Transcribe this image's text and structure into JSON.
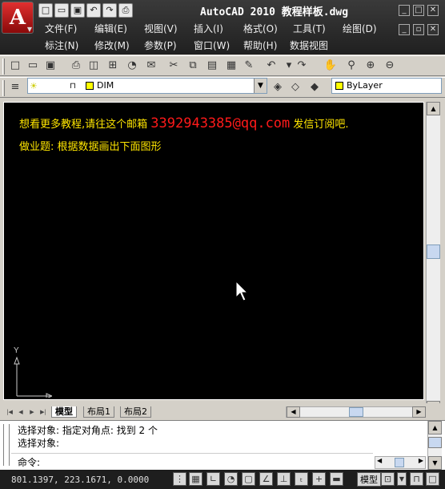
{
  "window": {
    "title": "AutoCAD 2010   教程样板.dwg",
    "logo_letter": "A"
  },
  "menus": {
    "row1": [
      "文件(F)",
      "编辑(E)",
      "视图(V)",
      "插入(I)",
      "格式(O)",
      "工具(T)",
      "绘图(D)"
    ],
    "row2": [
      "标注(N)",
      "修改(M)",
      "参数(P)",
      "窗口(W)",
      "帮助(H)",
      "数据视图"
    ]
  },
  "layer_toolbar": {
    "layer_name": "DIM",
    "color_value": "ByLayer",
    "layer_color": "#ffff00"
  },
  "drawing": {
    "line1_prefix": "想看更多教程,请往这个邮箱",
    "email": "3392943385@qq.com",
    "line1_suffix": "发信订阅吧.",
    "line2": "做业题: 根据数据画出下面图形",
    "text_color": "#ffe600",
    "email_color": "#ff1a1a",
    "ucs_y": "Y",
    "ucs_x": "X"
  },
  "tabs": [
    "模型",
    "布局1",
    "布局2"
  ],
  "active_tab": "模型",
  "command": {
    "history": [
      "选择对象: 指定对角点: 找到 2 个",
      "选择对象:"
    ],
    "prompt": "命令:"
  },
  "status": {
    "coords": "801.1397,  223.1671,  0.0000",
    "model_label": "模型"
  },
  "icons": {
    "quick_access": [
      "new-icon",
      "open-icon",
      "save-icon",
      "undo-icon",
      "redo-icon",
      "plot-icon"
    ],
    "standard": [
      "new-icon",
      "open-icon",
      "save-icon",
      "print-icon",
      "preview-icon",
      "publish-icon",
      "3d-dwf-icon",
      "cut-icon",
      "copy-icon",
      "paste-icon",
      "match-icon",
      "block-editor-icon",
      "undo-icon",
      "redo-icon",
      "pan-icon",
      "zoom-realtime-icon",
      "zoom-window-icon",
      "zoom-previous-icon"
    ],
    "status_toggles": [
      "snap-icon",
      "grid-icon",
      "ortho-icon",
      "polar-icon",
      "osnap-icon",
      "otrack-icon",
      "ducs-icon",
      "dyn-icon",
      "lineweight-icon",
      "qp-icon"
    ]
  }
}
